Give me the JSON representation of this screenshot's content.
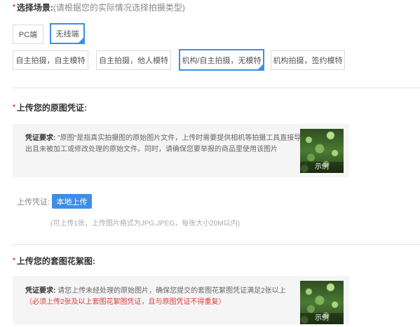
{
  "scene": {
    "title": "选择场景:",
    "hint": "(请根据您的实际情况选择拍摄类型)",
    "platforms": [
      {
        "label": "PC端",
        "selected": false
      },
      {
        "label": "无线端",
        "selected": true
      }
    ],
    "types": [
      {
        "label": "自主拍摄，自主模特",
        "selected": false
      },
      {
        "label": "自主拍摄，他人模特",
        "selected": false
      },
      {
        "label": "机构/自主拍摄，无模特",
        "selected": true
      },
      {
        "label": "机构拍摄，签约模特",
        "selected": false
      }
    ]
  },
  "original": {
    "title": "上传您的原图凭证:",
    "req_label": "凭证要求:",
    "req_text": " \"原图\"是指真实拍摄图的原始图片文件，上传时需要提供相机等拍摄工具直接导出且未被加工或修改处理的原始文件。同时，请确保您要举报的商品里使用该图片",
    "example_label": "示例",
    "upload_label": "上传凭证:",
    "upload_button": "本地上传",
    "upload_note": "(可上传1张，上传图片格式为JPG,JPEG，每张大小20M以内)"
  },
  "theft": {
    "title": "上传您的套图花絮图:",
    "req_label": "凭证要求:",
    "req_text": " 请您上传未经处理的原始图片，确保您提交的套图花絮图凭证满足2张以上",
    "req_warn": "（必须上传2张及以上套图花絮图凭证，且与原图凭证不得重复）",
    "example_label": "示例"
  }
}
